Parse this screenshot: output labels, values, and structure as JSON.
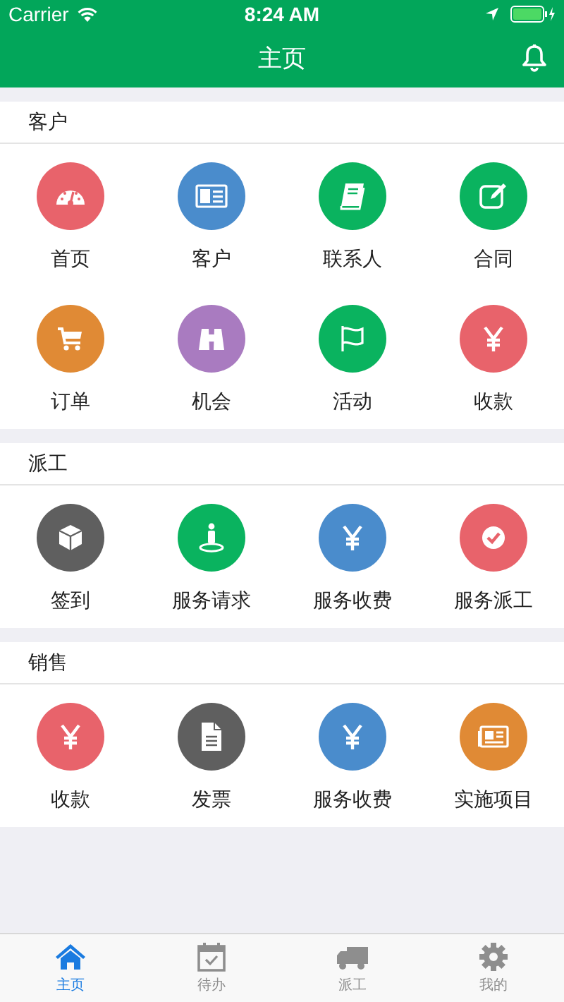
{
  "status_bar": {
    "carrier": "Carrier",
    "time": "8:24 AM"
  },
  "header": {
    "title": "主页"
  },
  "sections": [
    {
      "title": "客户",
      "items": [
        {
          "label": "首页",
          "color": "#e8636b"
        },
        {
          "label": "客户",
          "color": "#4a8ccc"
        },
        {
          "label": "联系人",
          "color": "#0ab35f"
        },
        {
          "label": "合同",
          "color": "#0ab35f"
        },
        {
          "label": "订单",
          "color": "#e08a35"
        },
        {
          "label": "机会",
          "color": "#a97bc0"
        },
        {
          "label": "活动",
          "color": "#0ab35f"
        },
        {
          "label": "收款",
          "color": "#e8636b"
        }
      ]
    },
    {
      "title": "派工",
      "items": [
        {
          "label": "签到",
          "color": "#5f5f5f"
        },
        {
          "label": "服务请求",
          "color": "#0ab35f"
        },
        {
          "label": "服务收费",
          "color": "#4a8ccc"
        },
        {
          "label": "服务派工",
          "color": "#e8636b"
        }
      ]
    },
    {
      "title": "销售",
      "items": [
        {
          "label": "收款",
          "color": "#e8636b"
        },
        {
          "label": "发票",
          "color": "#5f5f5f"
        },
        {
          "label": "服务收费",
          "color": "#4a8ccc"
        },
        {
          "label": "实施项目",
          "color": "#e08a35"
        }
      ]
    }
  ],
  "tabs": [
    {
      "label": "主页",
      "selected": true
    },
    {
      "label": "待办",
      "selected": false
    },
    {
      "label": "派工",
      "selected": false
    },
    {
      "label": "我的",
      "selected": false
    }
  ]
}
